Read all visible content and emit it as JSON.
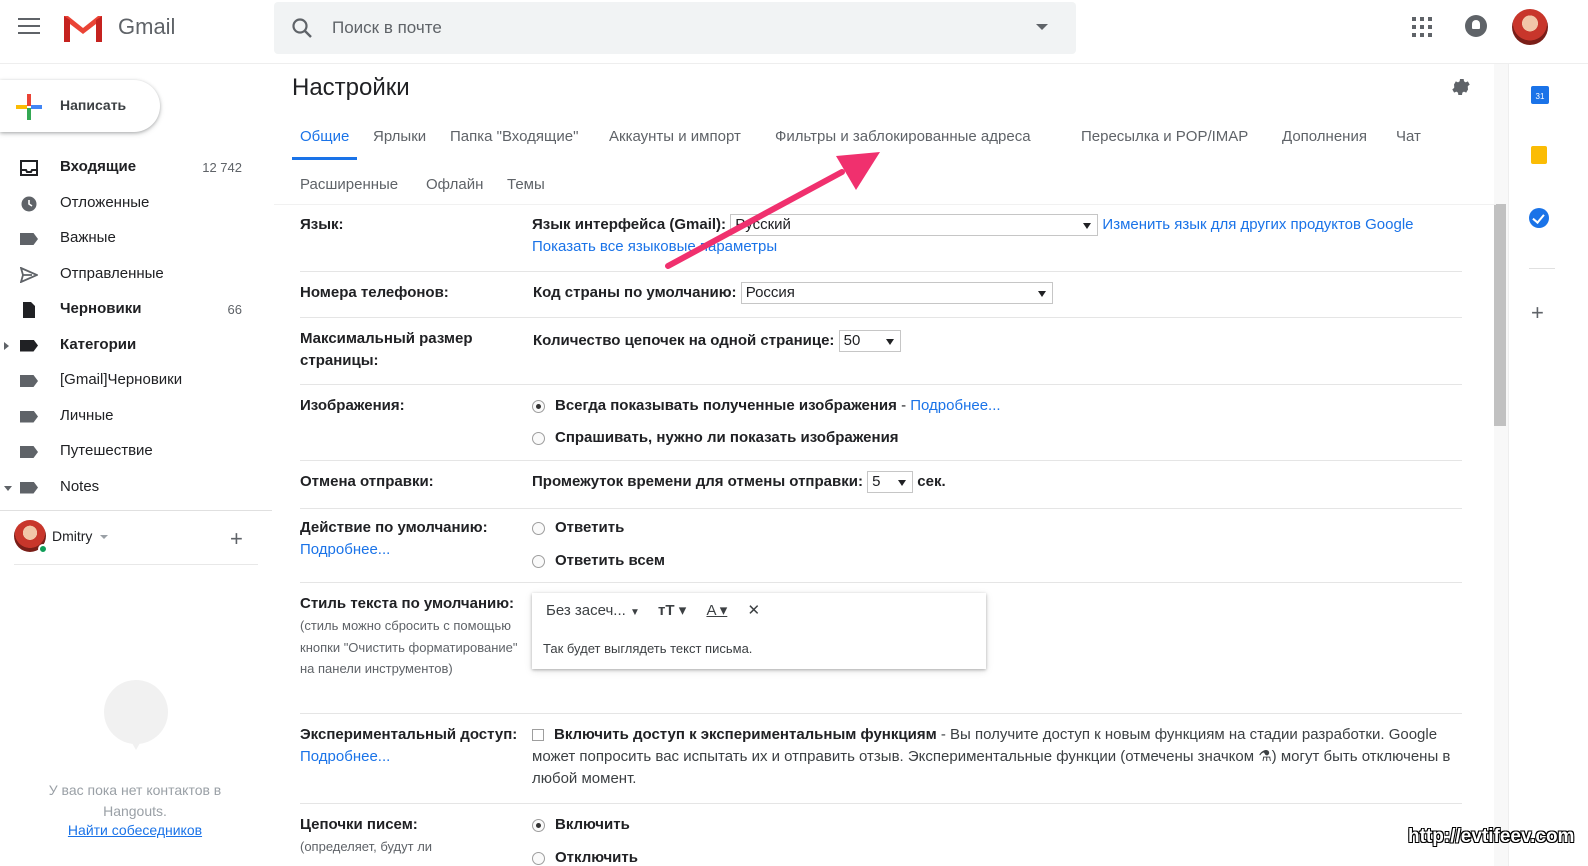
{
  "app": {
    "title": "Gmail"
  },
  "search": {
    "placeholder": "Поиск в почте"
  },
  "compose": {
    "label": "Написать"
  },
  "nav": {
    "items": [
      {
        "label": "Входящие",
        "count": "12 742"
      },
      {
        "label": "Отложенные",
        "count": ""
      },
      {
        "label": "Важные",
        "count": ""
      },
      {
        "label": "Отправленные",
        "count": ""
      },
      {
        "label": "Черновики",
        "count": "66"
      },
      {
        "label": "Категории",
        "count": ""
      },
      {
        "label": "[Gmail]Черновики",
        "count": ""
      },
      {
        "label": "Личные",
        "count": ""
      },
      {
        "label": "Путешествие",
        "count": ""
      },
      {
        "label": "Notes",
        "count": ""
      }
    ]
  },
  "hangouts": {
    "user_name": "Dmitry",
    "empty_text": "У вас пока нет контактов в Hangouts.",
    "find_link": "Найти собеседников"
  },
  "settings": {
    "title": "Настройки",
    "tabs_row1": [
      "Общие",
      "Ярлыки",
      "Папка \"Входящие\"",
      "Аккаунты и импорт",
      "Фильтры и заблокированные адреса",
      "Пересылка и POP/IMAP",
      "Дополнения",
      "Чат"
    ],
    "tabs_row2": [
      "Расширенные",
      "Офлайн",
      "Темы"
    ],
    "language": {
      "label": "Язык:",
      "field_label": "Язык интерфейса (Gmail):",
      "value": "Русский",
      "link_other": "Изменить язык для других продуктов Google",
      "link_all": "Показать все языковые параметры"
    },
    "phones": {
      "label": "Номера телефонов:",
      "field_label": "Код страны по умолчанию:",
      "value": "Россия"
    },
    "page_size": {
      "label": "Максимальный размер страницы:",
      "field_label": "Количество цепочек на одной странице:",
      "value": "50"
    },
    "images": {
      "label": "Изображения:",
      "option1": "Всегда показывать полученные изображения",
      "option1_link": "Подробнее...",
      "option2": "Спрашивать, нужно ли показать изображения"
    },
    "undo_send": {
      "label": "Отмена отправки:",
      "field_label": "Промежуток времени для отмены отправки:",
      "value": "5",
      "unit": "сек."
    },
    "default_action": {
      "label": "Действие по умолчанию:",
      "link": "Подробнее...",
      "option1": "Ответить",
      "option2": "Ответить всем"
    },
    "text_style": {
      "label": "Стиль текста по умолчанию:",
      "note": "(стиль можно сбросить с помощью кнопки \"Очистить форматирование\" на панели инструментов)",
      "font": "Без засеч...",
      "preview": "Так будет выглядеть текст письма."
    },
    "experimental": {
      "label": "Экспериментальный доступ:",
      "link": "Подробнее...",
      "option": "Включить доступ к экспериментальным функциям",
      "description": " - Вы получите доступ к новым функциям на стадии разработки. Google может попросить вас испытать их и отправить отзыв. Экспериментальные функции (отмечены значком ⚗) могут быть отключены в любой момент."
    },
    "threads": {
      "label": "Цепочки писем:",
      "note": "(определяет, будут ли",
      "option1": "Включить",
      "option2": "Отключить"
    }
  },
  "watermark": "http://evtifeev.com",
  "colors": {
    "accent": "#1a73e8",
    "arrow": "#f0306e",
    "gmail_red": "#ea4335"
  }
}
